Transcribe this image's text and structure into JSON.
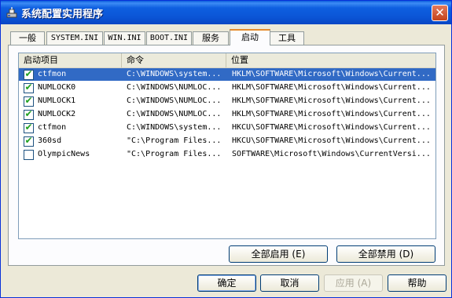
{
  "window": {
    "title": "系统配置实用程序",
    "close_glyph": "✕"
  },
  "tabs": [
    {
      "label": "一般"
    },
    {
      "label": "SYSTEM.INI"
    },
    {
      "label": "WIN.INI"
    },
    {
      "label": "BOOT.INI"
    },
    {
      "label": "服务"
    },
    {
      "label": "启动",
      "active": true
    },
    {
      "label": "工具"
    }
  ],
  "list": {
    "columns": [
      "启动项目",
      "命令",
      "位置"
    ],
    "rows": [
      {
        "checked": true,
        "selected": true,
        "item": "ctfmon",
        "command": "C:\\WINDOWS\\system...",
        "location": "HKLM\\SOFTWARE\\Microsoft\\Windows\\Current..."
      },
      {
        "checked": true,
        "selected": false,
        "item": "NUMLOCK0",
        "command": "C:\\WINDOWS\\NUMLOC...",
        "location": "HKLM\\SOFTWARE\\Microsoft\\Windows\\Current..."
      },
      {
        "checked": true,
        "selected": false,
        "item": "NUMLOCK1",
        "command": "C:\\WINDOWS\\NUMLOC...",
        "location": "HKLM\\SOFTWARE\\Microsoft\\Windows\\Current..."
      },
      {
        "checked": true,
        "selected": false,
        "item": "NUMLOCK2",
        "command": "C:\\WINDOWS\\NUMLOC...",
        "location": "HKLM\\SOFTWARE\\Microsoft\\Windows\\Current..."
      },
      {
        "checked": true,
        "selected": false,
        "item": "ctfmon",
        "command": "C:\\WINDOWS\\system...",
        "location": "HKCU\\SOFTWARE\\Microsoft\\Windows\\Current..."
      },
      {
        "checked": true,
        "selected": false,
        "item": "360sd",
        "command": "\"C:\\Program Files...",
        "location": "HKCU\\SOFTWARE\\Microsoft\\Windows\\Current..."
      },
      {
        "checked": false,
        "selected": false,
        "item": "OlympicNews",
        "command": "\"C:\\Program Files...",
        "location": "SOFTWARE\\Microsoft\\Windows\\CurrentVersi..."
      }
    ]
  },
  "buttons": {
    "enable_all": "全部启用 (E)",
    "disable_all": "全部禁用 (D)",
    "ok": "确定",
    "cancel": "取消",
    "apply": "应用 (A)",
    "help": "帮助"
  },
  "colors": {
    "selection": "#316ac5",
    "check": "#21a121",
    "title_bar": "#0b55d6"
  }
}
